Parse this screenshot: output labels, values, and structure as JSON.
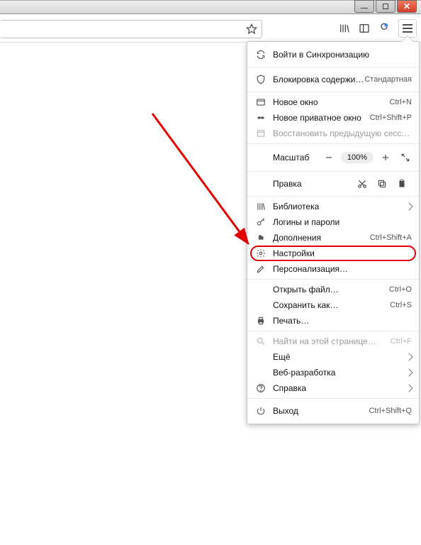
{
  "window": {
    "min": "_",
    "max": "❐",
    "close": "✕"
  },
  "menu": {
    "sync": "Войти в Синхронизацию",
    "blocking_label": "Блокировка содержимого",
    "blocking_value": "Стандартная",
    "new_window": "Новое окно",
    "new_window_key": "Ctrl+N",
    "new_private": "Новое приватное окно",
    "new_private_key": "Ctrl+Shift+P",
    "restore": "Восстановить предыдущую сессию",
    "zoom_label": "Масштаб",
    "zoom_value": "100%",
    "edit_label": "Правка",
    "library": "Библиотека",
    "logins": "Логины и пароли",
    "addons": "Дополнения",
    "addons_key": "Ctrl+Shift+A",
    "settings": "Настройки",
    "personalize": "Персонализация…",
    "open_file": "Открыть файл…",
    "open_file_key": "Ctrl+O",
    "save_as": "Сохранить как…",
    "save_as_key": "Ctrl+S",
    "print": "Печать…",
    "find": "Найти на этой странице…",
    "find_key": "Ctrl+F",
    "more": "Ещё",
    "webdev": "Веб-разработка",
    "help": "Справка",
    "exit": "Выход",
    "exit_key": "Ctrl+Shift+Q"
  }
}
